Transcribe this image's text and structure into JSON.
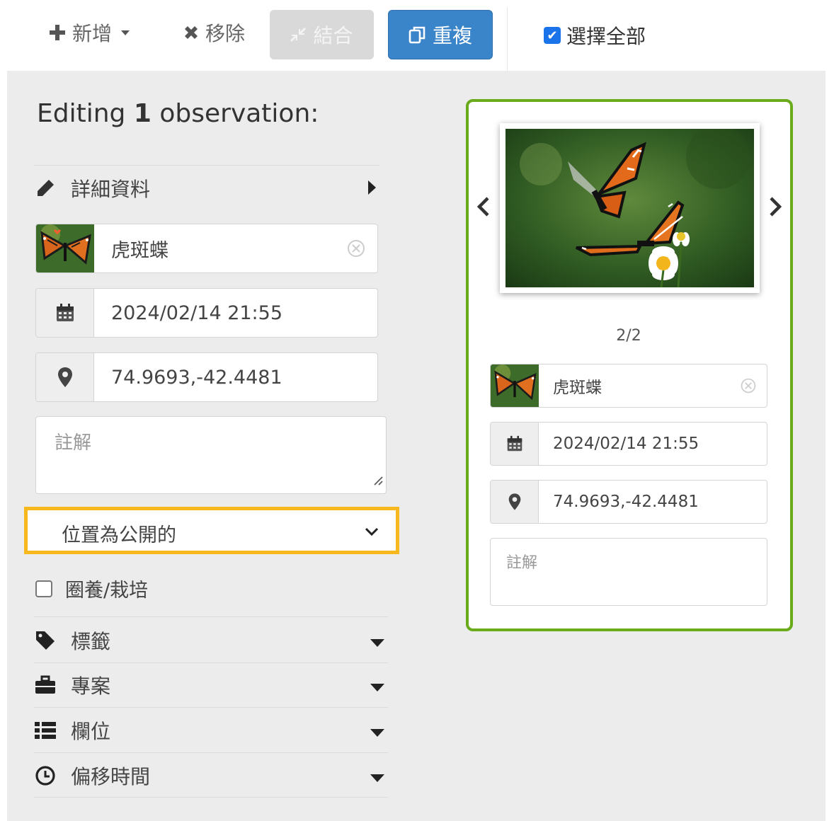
{
  "toolbar": {
    "add_label": "新增",
    "remove_label": "移除",
    "combine_label": "結合",
    "duplicate_label": "重複",
    "select_all_label": "選擇全部",
    "select_all_checked": true
  },
  "editor": {
    "title_prefix": "Editing",
    "title_count": "1",
    "title_suffix": "observation:",
    "details_label": "詳細資料",
    "species": "虎斑蝶",
    "datetime": "2024/02/14 21:55",
    "location": "74.9693,-42.4481",
    "notes_placeholder": "註解",
    "geoprivacy": "位置為公開的",
    "captive_label": "圈養/栽培",
    "captive_checked": false,
    "sections": [
      {
        "label": "標籤",
        "icon": "tag-icon"
      },
      {
        "label": "專案",
        "icon": "briefcase-icon"
      },
      {
        "label": "欄位",
        "icon": "list-icon"
      },
      {
        "label": "偏移時間",
        "icon": "clock-icon"
      }
    ]
  },
  "card": {
    "photo_counter": "2/2",
    "species": "虎斑蝶",
    "datetime": "2024/02/14 21:55",
    "location": "74.9693,-42.4481",
    "notes_placeholder": "註解"
  },
  "colors": {
    "primary_button": "#3a84c9",
    "card_border": "#6aab1c",
    "highlight": "#f6b81c",
    "panel_bg": "#ececec"
  }
}
